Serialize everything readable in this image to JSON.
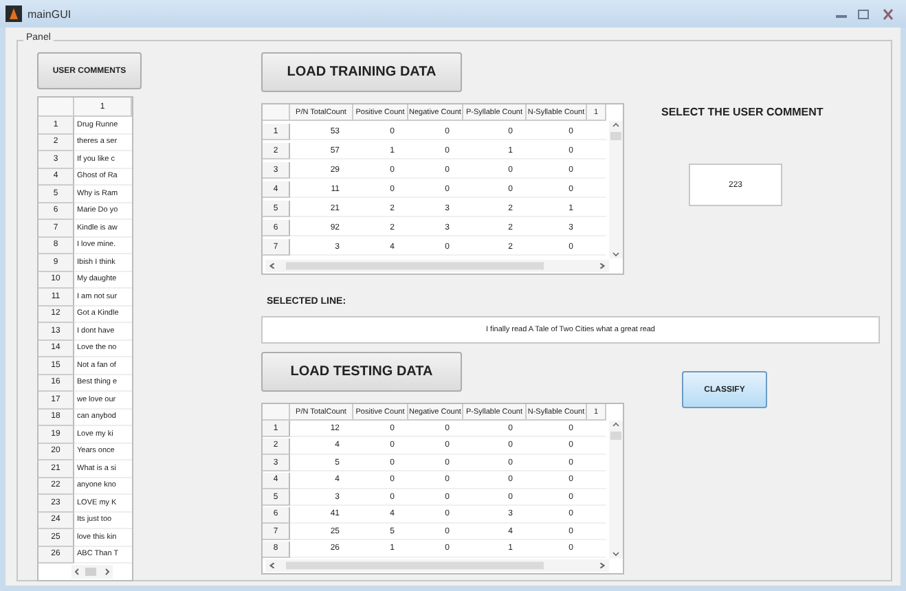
{
  "window": {
    "title": "mainGUI"
  },
  "panel": {
    "title": "Panel"
  },
  "user_comments_button": "USER COMMENTS",
  "comments_table": {
    "column": "1",
    "rows": [
      {
        "index": "1",
        "text": "Drug Runne"
      },
      {
        "index": "2",
        "text": "theres a ser"
      },
      {
        "index": "3",
        "text": "If you like c"
      },
      {
        "index": "4",
        "text": "Ghost of Ra"
      },
      {
        "index": "5",
        "text": "Why is Ram"
      },
      {
        "index": "6",
        "text": "Marie Do yo"
      },
      {
        "index": "7",
        "text": "Kindle is aw"
      },
      {
        "index": "8",
        "text": "I love mine."
      },
      {
        "index": "9",
        "text": "Ibish I think"
      },
      {
        "index": "10",
        "text": "My daughte"
      },
      {
        "index": "11",
        "text": "I am not sur"
      },
      {
        "index": "12",
        "text": "Got a Kindle"
      },
      {
        "index": "13",
        "text": "I dont have"
      },
      {
        "index": "14",
        "text": "Love the no"
      },
      {
        "index": "15",
        "text": "Not a fan of"
      },
      {
        "index": "16",
        "text": "Best thing e"
      },
      {
        "index": "17",
        "text": "we love our"
      },
      {
        "index": "18",
        "text": "can anybod"
      },
      {
        "index": "19",
        "text": "Love my ki"
      },
      {
        "index": "20",
        "text": "Years once"
      },
      {
        "index": "21",
        "text": "What is a si"
      },
      {
        "index": "22",
        "text": "anyone kno"
      },
      {
        "index": "23",
        "text": "LOVE my K"
      },
      {
        "index": "24",
        "text": "Its just too"
      },
      {
        "index": "25",
        "text": "love this kin"
      },
      {
        "index": "26",
        "text": "ABC Than T"
      }
    ]
  },
  "training": {
    "button": "LOAD TRAINING DATA",
    "columns": [
      "P/N TotalCount",
      "Positive Count",
      "Negative Count",
      "P-Syllable Count",
      "N-Syllable Count",
      "1"
    ],
    "rows": [
      {
        "index": "1",
        "cells": [
          "53",
          "0",
          "0",
          "0",
          "0"
        ]
      },
      {
        "index": "2",
        "cells": [
          "57",
          "1",
          "0",
          "1",
          "0"
        ]
      },
      {
        "index": "3",
        "cells": [
          "29",
          "0",
          "0",
          "0",
          "0"
        ]
      },
      {
        "index": "4",
        "cells": [
          "11",
          "0",
          "0",
          "0",
          "0"
        ]
      },
      {
        "index": "5",
        "cells": [
          "21",
          "2",
          "3",
          "2",
          "1"
        ]
      },
      {
        "index": "6",
        "cells": [
          "92",
          "2",
          "3",
          "2",
          "3"
        ]
      },
      {
        "index": "7",
        "cells": [
          "3",
          "4",
          "0",
          "2",
          "0"
        ]
      }
    ]
  },
  "select_label": "SELECT THE USER COMMENT",
  "comment_number": {
    "value": "223"
  },
  "selected_line": {
    "label": "SELECTED LINE:",
    "value": "I finally read A Tale of Two Cities what a great read"
  },
  "testing": {
    "button": "LOAD TESTING DATA",
    "columns": [
      "P/N TotalCount",
      "Positive Count",
      "Negative Count",
      "P-Syllable Count",
      "N-Syllable Count",
      "1"
    ],
    "rows": [
      {
        "index": "1",
        "cells": [
          "12",
          "0",
          "0",
          "0",
          "0"
        ]
      },
      {
        "index": "2",
        "cells": [
          "4",
          "0",
          "0",
          "0",
          "0"
        ]
      },
      {
        "index": "3",
        "cells": [
          "5",
          "0",
          "0",
          "0",
          "0"
        ]
      },
      {
        "index": "4",
        "cells": [
          "4",
          "0",
          "0",
          "0",
          "0"
        ]
      },
      {
        "index": "5",
        "cells": [
          "3",
          "0",
          "0",
          "0",
          "0"
        ]
      },
      {
        "index": "6",
        "cells": [
          "41",
          "4",
          "0",
          "3",
          "0"
        ]
      },
      {
        "index": "7",
        "cells": [
          "25",
          "5",
          "0",
          "4",
          "0"
        ]
      },
      {
        "index": "8",
        "cells": [
          "26",
          "1",
          "0",
          "1",
          "0"
        ]
      }
    ]
  },
  "classify_button": "CLASSIFY"
}
